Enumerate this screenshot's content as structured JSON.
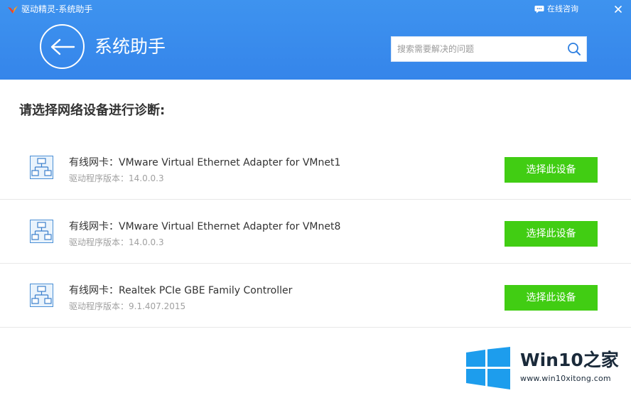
{
  "titlebar": {
    "app_title": "驱动精灵-系统助手",
    "consult_label": "在线咨询",
    "close_glyph": "x"
  },
  "header": {
    "page_title": "系统助手",
    "search": {
      "placeholder": "搜索需要解决的问题",
      "value": ""
    }
  },
  "main": {
    "prompt": "请选择网络设备进行诊断:",
    "devices": [
      {
        "name": "有线网卡：VMware Virtual Ethernet Adapter for VMnet1",
        "version": "驱动程序版本：14.0.0.3",
        "button_label": "选择此设备"
      },
      {
        "name": "有线网卡：VMware Virtual Ethernet Adapter for VMnet8",
        "version": "驱动程序版本：14.0.0.3",
        "button_label": "选择此设备"
      },
      {
        "name": "有线网卡：Realtek PCIe GBE Family Controller",
        "version": "驱动程序版本：9.1.407.2015",
        "button_label": "选择此设备"
      }
    ]
  },
  "watermark": {
    "brand": "Win10之家",
    "url": "www.win10xitong.com"
  },
  "colors": {
    "header_blue": "#3585ea",
    "button_green": "#41cd13",
    "logo_blue": "#1d9ded",
    "text_dark": "#333333",
    "text_muted": "#a0a0a0"
  },
  "icons": {
    "app_logo": "bird-logo-icon",
    "consult": "chat-bubble-icon",
    "back": "arrow-left-icon",
    "search": "magnifier-icon",
    "device": "network-icon"
  }
}
